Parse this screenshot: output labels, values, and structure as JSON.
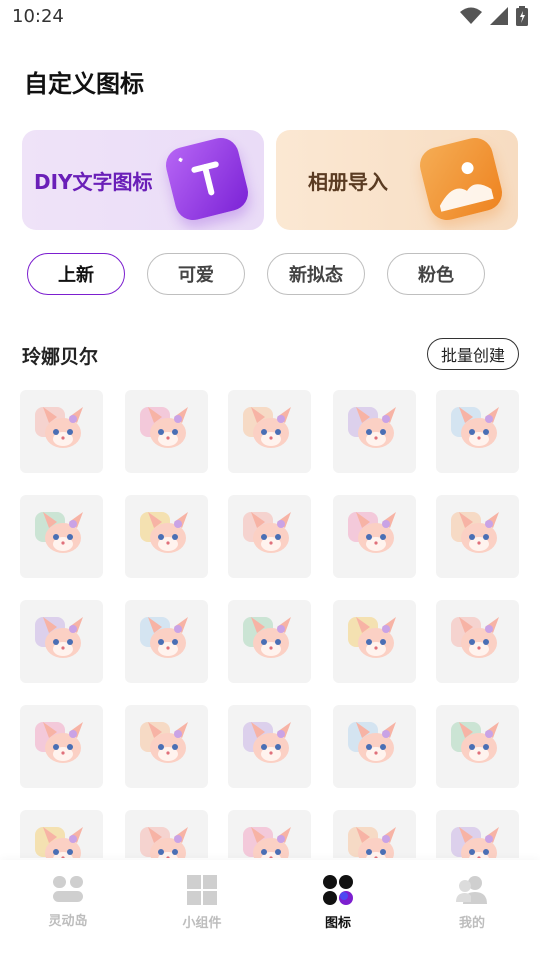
{
  "status": {
    "time": "10:24"
  },
  "page": {
    "title": "自定义图标"
  },
  "hero": {
    "diy_label": "DIY文字图标",
    "album_label": "相册导入",
    "colors": {
      "diy_bg": "#efe3f8",
      "diy_accent": "#7b22d6",
      "album_bg": "#fbe8d3",
      "album_accent": "#ee8320"
    }
  },
  "tabs": [
    "上新",
    "可爱",
    "新拟态",
    "粉色"
  ],
  "section": {
    "title": "玲娜贝尔",
    "batch_label": "批量创建"
  },
  "icons": {
    "rows": [
      [
        "linabell-book-icon",
        "linabell-app-icon",
        "linabell-clock-icon",
        "linabell-music-icon",
        "linabell-alipay-icon"
      ],
      [
        "linabell-qq-icon",
        "linabell-iqiyi-icon",
        "linabell-bilibili-icon",
        "linabell-tiktok-icon",
        "linabell-wechat-icon"
      ],
      [
        "linabell-notebook-icon",
        "linabell-radio-icon",
        "linabell-chat-icon",
        "linabell-dress-icon",
        "linabell-weather-icon"
      ],
      [
        "linabell-mango-icon",
        "linabell-video-icon",
        "linabell-kuaishou-icon",
        "linabell-photo-icon",
        "linabell-notes-icon"
      ],
      [
        "linabell-wing-icon",
        "linabell-calendar-icon",
        "linabell-flower-icon",
        "linabell-calculator-icon",
        "linabell-cap-icon"
      ]
    ]
  },
  "nav": [
    {
      "label": "灵动岛",
      "icon": "dynamic-island-icon",
      "active": false
    },
    {
      "label": "小组件",
      "icon": "widgets-icon",
      "active": false
    },
    {
      "label": "图标",
      "icon": "icons-icon",
      "active": true
    },
    {
      "label": "我的",
      "icon": "profile-icon",
      "active": false
    }
  ],
  "accent": "#7c1fcf"
}
